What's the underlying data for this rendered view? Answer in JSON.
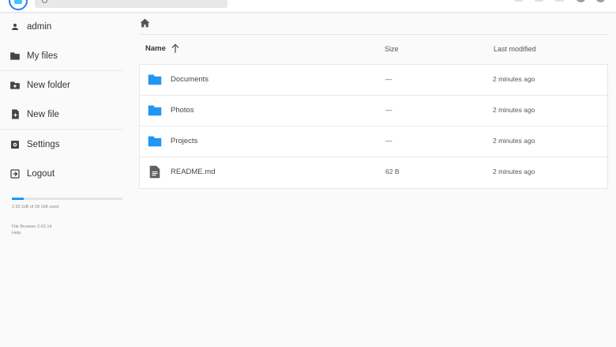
{
  "header": {
    "search_placeholder": ""
  },
  "sidebar": {
    "items": [
      {
        "label": "admin",
        "icon": "person-icon"
      },
      {
        "label": "My files",
        "icon": "folder-icon"
      },
      {
        "label": "New folder",
        "icon": "create-folder-icon"
      },
      {
        "label": "New file",
        "icon": "note-add-icon"
      },
      {
        "label": "Settings",
        "icon": "settings-icon"
      },
      {
        "label": "Logout",
        "icon": "logout-icon"
      }
    ],
    "quota": {
      "text": "2.93 GiB of 28 GiB used",
      "used_fraction": 0.105
    },
    "version": "File Browser 2.63.14",
    "help": "Help"
  },
  "breadcrumb": {
    "icon": "home-icon"
  },
  "listing": {
    "columns": {
      "name": "Name",
      "size": "Size",
      "modified": "Last modified"
    },
    "sort_icon": "arrow-up-icon",
    "files": [
      {
        "name": "Documents",
        "size": "—",
        "modified": "2 minutes ago",
        "type": "folder"
      },
      {
        "name": "Photos",
        "size": "—",
        "modified": "2 minutes ago",
        "type": "folder"
      },
      {
        "name": "Projects",
        "size": "—",
        "modified": "2 minutes ago",
        "type": "folder"
      },
      {
        "name": "README.md",
        "size": "62 B",
        "modified": "2 minutes ago",
        "type": "file"
      }
    ]
  },
  "colors": {
    "accent": "#2196f3",
    "folder": "#2196f3",
    "file": "#616161"
  }
}
